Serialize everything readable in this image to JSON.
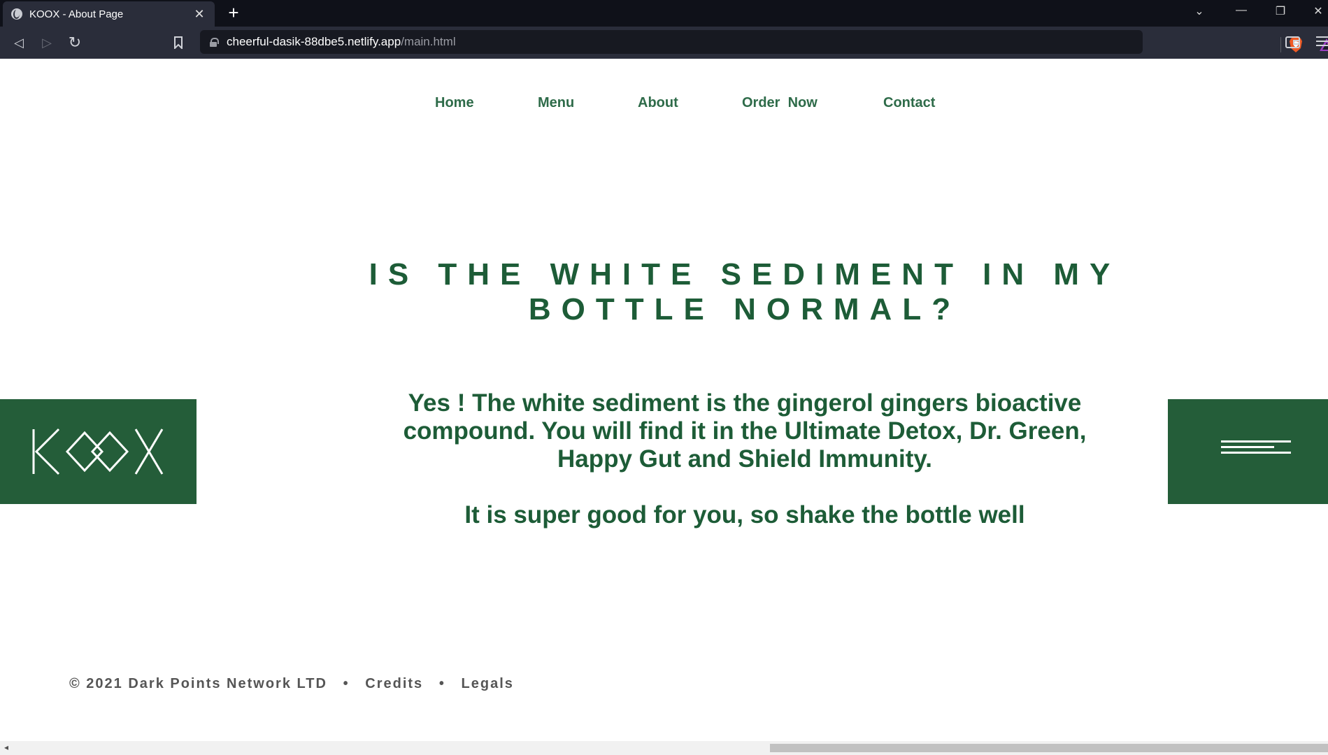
{
  "browser": {
    "tab_title": "KOOX - About Page",
    "tab_close": "✕",
    "new_tab": "+",
    "url_host": "cheerful-dasik-88dbe5.netlify.app",
    "url_path": "/main.html",
    "back": "◁",
    "forward": "▷",
    "reload": "↻",
    "bookmark": "🔖",
    "minimize": "—",
    "restore": "❐",
    "close": "✕",
    "tab_list": "⌄",
    "rewards_badge": "1"
  },
  "nav": {
    "items": [
      "Home",
      "Menu",
      "About",
      "Order  Now",
      "Contact"
    ]
  },
  "main": {
    "headline": "IS THE WHITE SEDIMENT IN MY BOTTLE NORMAL?",
    "paragraph_1": "Yes ! The white sediment is the gingerol gingers bioactive compound. You will find it in the Ultimate Detox, Dr. Green, Happy Gut and Shield Immunity.",
    "paragraph_2": "It is super good for you, so shake the bottle well"
  },
  "logo": {
    "text": "KOOX"
  },
  "footer": {
    "copyright": "© 2021 Dark Points Network LTD",
    "separator": "•",
    "credits": "Credits",
    "legals": "Legals"
  },
  "colors": {
    "brand_green": "#245d39",
    "text_green": "#1d5c37",
    "nav_green": "#2e6b49"
  }
}
